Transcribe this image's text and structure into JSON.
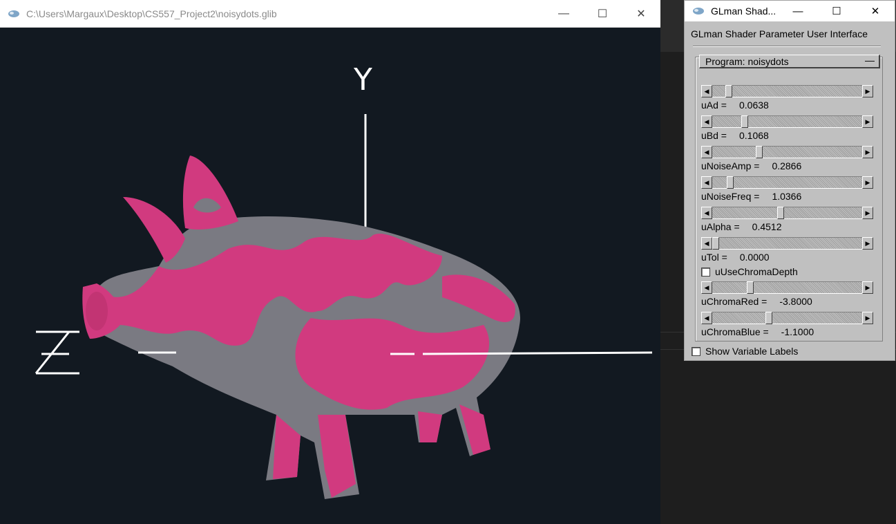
{
  "main_window": {
    "title": "C:\\Users\\Margaux\\Desktop\\CS557_Project2\\noisydots.glib",
    "controls": {
      "minimize": "—",
      "maximize": "☐",
      "close": "✕"
    },
    "axes": {
      "y_label": "Y",
      "z_label": "Z"
    },
    "colors": {
      "background": "#121921",
      "pig_pink": "#d13a7f",
      "pig_gray": "#7a7a82"
    }
  },
  "glman_panel": {
    "window_title": "GLman Shad...",
    "heading": "GLman Shader Parameter User Interface",
    "program_label": "Program: noisydots",
    "program_collapse": "—",
    "sliders": [
      {
        "name": "uAd =",
        "value": "0.0638",
        "fraction": 0.09
      },
      {
        "name": "uBd =",
        "value": "0.1068",
        "fraction": 0.2
      },
      {
        "name": "uNoiseAmp =",
        "value": "0.2866",
        "fraction": 0.3
      },
      {
        "name": "uNoiseFreq =",
        "value": "1.0366",
        "fraction": 0.1
      },
      {
        "name": "uAlpha =",
        "value": "0.4512",
        "fraction": 0.45
      },
      {
        "name": "uTol =",
        "value": "0.0000",
        "fraction": 0.0
      },
      {
        "name": "uChromaRed =",
        "value": "-3.8000",
        "fraction": 0.24
      },
      {
        "name": "uChromaBlue =",
        "value": "-1.1000",
        "fraction": 0.37
      }
    ],
    "checkbox_chroma": "uUseChromaDepth",
    "checkbox_labels": "Show Variable Labels",
    "controls": {
      "minimize": "—",
      "maximize": "☐",
      "close": "✕"
    }
  }
}
